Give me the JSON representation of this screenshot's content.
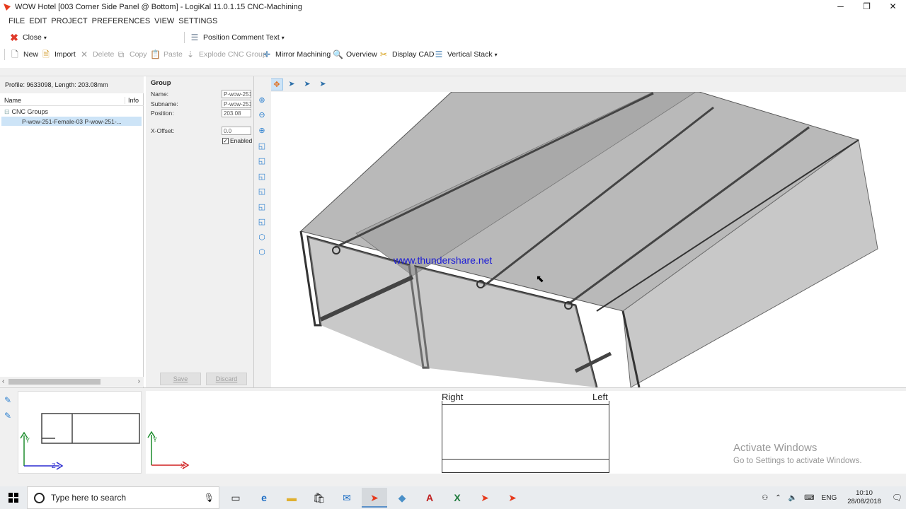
{
  "window": {
    "title": "WOW Hotel [003 Corner Side Panel @ Bottom] - LogiKal 11.0.1.15 CNC-Machining",
    "minimize": "─",
    "maximize": "❐",
    "close": "✕"
  },
  "menu": [
    "FILE",
    "EDIT",
    "PROJECT",
    "PREFERENCES",
    "VIEW",
    "SETTINGS"
  ],
  "toolbar1": {
    "close_label": "Close",
    "position_comment_label": "Position Comment Text"
  },
  "toolbar2": {
    "new": "New",
    "import": "Import",
    "delete": "Delete",
    "copy": "Copy",
    "paste": "Paste",
    "explode": "Explode CNC Group",
    "mirror": "Mirror Machining",
    "overview": "Overview",
    "display_cad": "Display CAD",
    "vertical_stack": "Vertical Stack"
  },
  "left_panel": {
    "profile_info": "Profile: 9633098, Length: 203.08mm",
    "col_name": "Name",
    "col_info": "Info",
    "tree_root": "CNC Groups",
    "tree_child": "P-wow-251-Female-03 P-wow-251-..."
  },
  "group": {
    "heading": "Group",
    "name_label": "Name:",
    "name_value": "P-wow-251",
    "subname_label": "Subname:",
    "subname_value": "P-wow-251",
    "position_label": "Position:",
    "position_value": "203.08",
    "xoffset_label": "X-Offset:",
    "xoffset_value": "0.0",
    "enabled_label": "Enabled",
    "save_label": "Save",
    "discard_label": "Discard"
  },
  "viewport": {
    "watermark": "www.thundershare.net"
  },
  "bottom": {
    "right_label": "Right",
    "left_label": "Left",
    "axis_y1": "Y",
    "axis_z": "Z",
    "axis_y2": "Y",
    "axis_x": "X",
    "activate_title": "Activate Windows",
    "activate_sub": "Go to Settings to activate Windows."
  },
  "taskbar": {
    "search_placeholder": "Type here to search",
    "lang": "ENG",
    "time": "10:10",
    "date": "28/08/2018"
  },
  "colors": {
    "accent_blue": "#2b7fcf",
    "selection": "#cde4f7",
    "watermark": "#1a1ad6"
  }
}
